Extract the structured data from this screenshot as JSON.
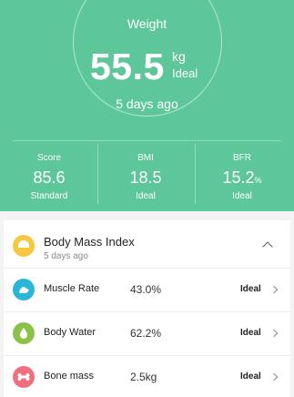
{
  "weight": {
    "label": "Weight",
    "value": "55.5",
    "unit": "kg",
    "status": "Ideal",
    "time": "5 days ago"
  },
  "stats": [
    {
      "label": "Score",
      "value": "85.6",
      "unit": "",
      "status": "Standard"
    },
    {
      "label": "BMI",
      "value": "18.5",
      "unit": "",
      "status": "Ideal"
    },
    {
      "label": "BFR",
      "value": "15.2",
      "unit": "%",
      "status": "Ideal"
    }
  ],
  "bmi_section": {
    "title": "Body Mass Index",
    "time": "5 days ago",
    "icon": "body-mass-index-icon"
  },
  "metrics": [
    {
      "label": "Muscle Rate",
      "value": "43.0%",
      "status": "Ideal",
      "icon": "muscle-icon",
      "color": "#29b6d8"
    },
    {
      "label": "Body Water",
      "value": "62.2%",
      "status": "Ideal",
      "icon": "water-drop-icon",
      "color": "#8bc34a"
    },
    {
      "label": "Bone mass",
      "value": "2.5kg",
      "status": "Ideal",
      "icon": "bone-icon",
      "color": "#f06f7f"
    }
  ],
  "colors": {
    "accent": "#5dc79a",
    "bmi_icon": "#f6c740"
  }
}
